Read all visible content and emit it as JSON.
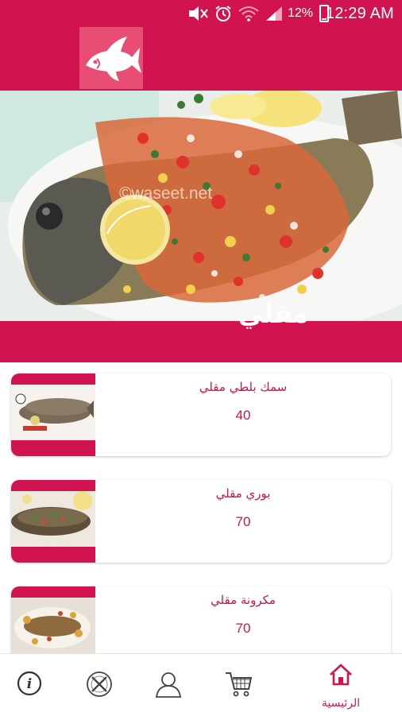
{
  "status_bar": {
    "battery": "12%",
    "time": "12:29 AM",
    "icons": [
      "mute-icon",
      "alarm-icon",
      "wifi-icon",
      "signal-icon",
      "battery-icon"
    ]
  },
  "app_bar": {
    "logo_icon": "fish-logo-icon"
  },
  "hero": {
    "watermark": "©waseet.net",
    "category_title": "مقلي"
  },
  "items": [
    {
      "name": "سمك بلطي مقلي",
      "price": "40"
    },
    {
      "name": "بوري مقلي",
      "price": "70"
    },
    {
      "name": "مكرونة مقلي",
      "price": "70"
    }
  ],
  "bottom_nav": {
    "home_label": "الرئيسية",
    "icons": [
      "info-icon",
      "restaurant-icon",
      "profile-icon",
      "cart-icon",
      "home-icon"
    ]
  },
  "colors": {
    "brand": "#d1144f",
    "logo_bg": "#e84d74",
    "text_accent": "#c8154e"
  }
}
